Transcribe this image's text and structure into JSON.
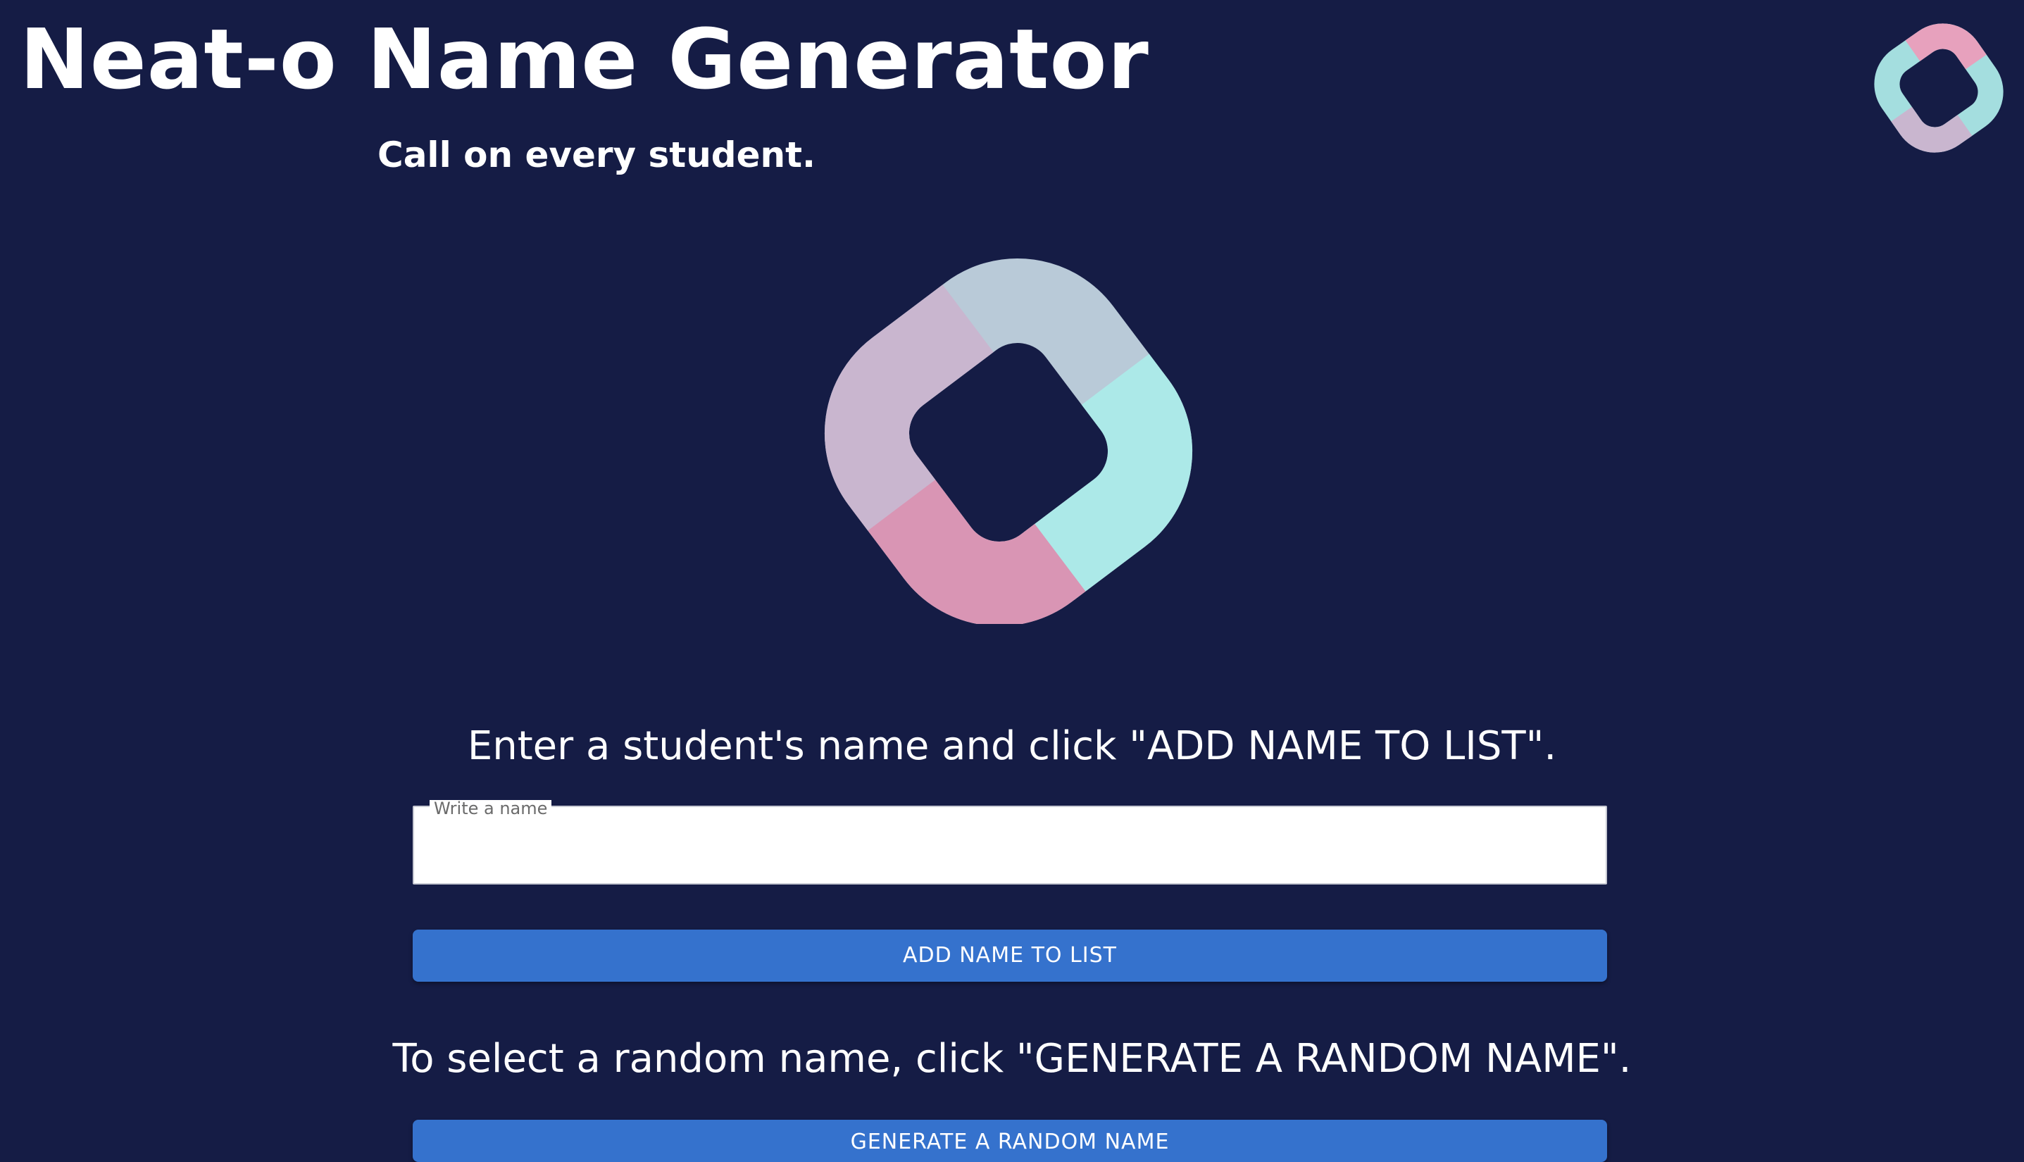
{
  "header": {
    "title": "Neat-o Name Generator",
    "subtitle": "Call on every student."
  },
  "logo": {
    "icon": "ring-logo-icon",
    "colors": {
      "pink": "#d995b4",
      "mauve": "#c9b6cf",
      "gray_blue": "#b9cad8",
      "aqua": "#ace9e8",
      "background": "#151c45"
    }
  },
  "add_section": {
    "instruction": "Enter a student's name and click \"ADD NAME TO LIST\".",
    "input_label": "Write a name",
    "input_value": "",
    "button_label": "ADD NAME TO LIST"
  },
  "random_section": {
    "instruction": "To select a random name, click \"GENERATE A RANDOM NAME\".",
    "button_label": "GENERATE A RANDOM NAME"
  },
  "theme": {
    "page_background": "#151c45",
    "button_color": "#3572cd",
    "text_color": "#ffffff"
  }
}
